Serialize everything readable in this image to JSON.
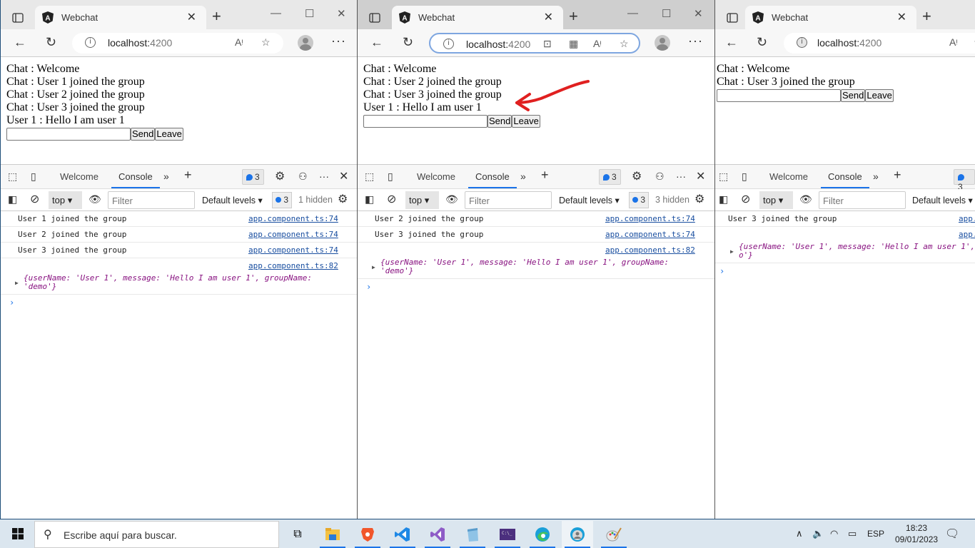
{
  "windows": [
    {
      "tab_title": "Webchat",
      "address_host": "localhost:",
      "address_port": "4200",
      "chat_messages": [
        "Chat : Welcome",
        "Chat : User 1 joined the group",
        "Chat : User 2 joined the group",
        "Chat : User 3 joined the group",
        "User 1 : Hello I am user 1"
      ],
      "message_input_value": "",
      "send_label": "Send",
      "leave_label": "Leave",
      "devtools": {
        "tabs": [
          "Welcome",
          "Console"
        ],
        "issues_count": "3",
        "context": "top",
        "filter_placeholder": "Filter",
        "levels": "Default levels",
        "toolbar_issues": "3",
        "hidden": "1 hidden",
        "logs": [
          {
            "text": "User 1 joined the group",
            "source": "app.component.ts:74"
          },
          {
            "text": "User 2 joined the group",
            "source": "app.component.ts:74"
          },
          {
            "text": "User 3 joined the group",
            "source": "app.component.ts:74"
          }
        ],
        "object_log": {
          "source": "app.component.ts:82",
          "text": "{userName: 'User 1', message: 'Hello I am user 1', groupName: 'demo'}"
        },
        "prompt": "›"
      }
    },
    {
      "tab_title": "Webchat",
      "address_host": "localhost:",
      "address_port": "4200",
      "chat_messages": [
        "Chat : Welcome",
        "Chat : User 2 joined the group",
        "Chat : User 3 joined the group",
        "User 1 : Hello I am user 1"
      ],
      "message_input_value": "",
      "send_label": "Send",
      "leave_label": "Leave",
      "devtools": {
        "tabs": [
          "Welcome",
          "Console"
        ],
        "issues_count": "3",
        "context": "top",
        "filter_placeholder": "Filter",
        "levels": "Default levels",
        "toolbar_issues": "3",
        "hidden": "3 hidden",
        "logs": [
          {
            "text": "User 2 joined the group",
            "source": "app.component.ts:74"
          },
          {
            "text": "User 3 joined the group",
            "source": "app.component.ts:74"
          }
        ],
        "object_log": {
          "source": "app.component.ts:82",
          "text": "{userName: 'User 1', message: 'Hello I am user 1', groupName: 'demo'}"
        },
        "prompt": "›"
      }
    },
    {
      "tab_title": "Webchat",
      "address_host": "localhost:",
      "address_port": "4200",
      "chat_messages": [
        "Chat : Welcome",
        "Chat : User 3 joined the group"
      ],
      "message_input_value": "",
      "send_label": "Send",
      "leave_label": "Leave",
      "devtools": {
        "tabs": [
          "Welcome",
          "Console"
        ],
        "issues_count": "3",
        "context": "top",
        "filter_placeholder": "Filter",
        "levels": "Default levels",
        "logs": [
          {
            "text": "User 3 joined the group",
            "source": "app."
          }
        ],
        "object_log": {
          "source": "app.",
          "text": "{userName: 'User 1', message: 'Hello I am user 1',\no'}"
        },
        "prompt": "›"
      }
    }
  ],
  "taskbar": {
    "search_placeholder": "Escribe aquí para buscar.",
    "apps": [
      "task-view",
      "file-explorer",
      "brave",
      "vscode",
      "visual-studio",
      "notepad",
      "terminal",
      "edge",
      "edge-profile",
      "paint"
    ],
    "language": "ESP",
    "time": "18:23",
    "date": "09/01/2023"
  },
  "colors": {
    "accent": "#1a73e8",
    "annotation_arrow": "#e02020",
    "object_text": "#881280",
    "link": "#1a4fa0"
  }
}
